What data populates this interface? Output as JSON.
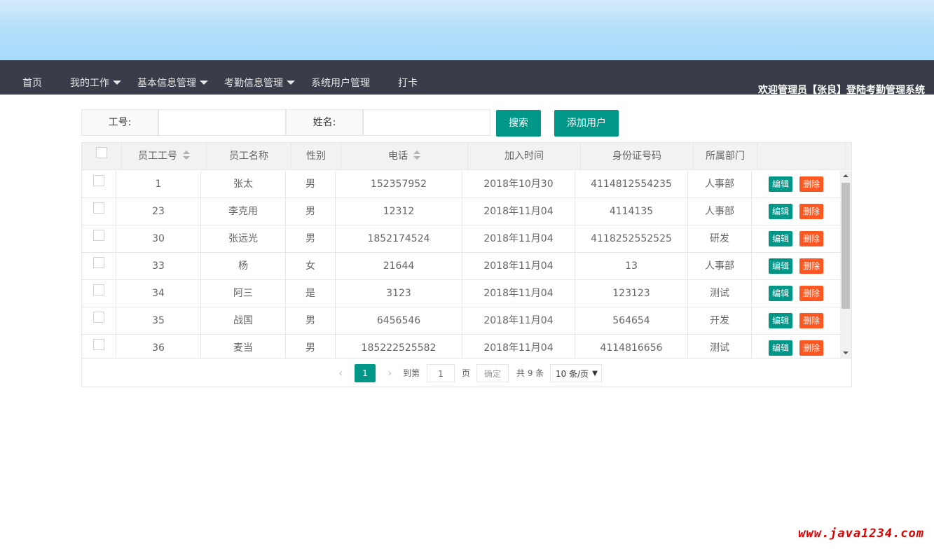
{
  "nav": {
    "items": [
      {
        "label": "首页",
        "dropdown": false
      },
      {
        "label": "我的工作",
        "dropdown": true
      },
      {
        "label": "基本信息管理",
        "dropdown": true
      },
      {
        "label": "考勤信息管理",
        "dropdown": true
      },
      {
        "label": "系统用户管理",
        "dropdown": false
      },
      {
        "label": "打卡",
        "dropdown": false
      }
    ],
    "welcome": "欢迎管理员【张良】登陆考勤管理系统"
  },
  "search": {
    "id_label": "工号:",
    "id_value": "",
    "name_label": "姓名:",
    "name_value": "",
    "search_button": "搜索",
    "add_button": "添加用户"
  },
  "table": {
    "columns": [
      "员工工号",
      "员工名称",
      "性别",
      "电话",
      "加入时间",
      "身份证号码",
      "所属部门"
    ],
    "rows": [
      {
        "id": "1",
        "name": "张太",
        "gender": "男",
        "phone": "152357952",
        "joined": "2018年10月30",
        "id_card": "4114812554235",
        "dept": "人事部"
      },
      {
        "id": "23",
        "name": "李克用",
        "gender": "男",
        "phone": "12312",
        "joined": "2018年11月04",
        "id_card": "4114135",
        "dept": "人事部"
      },
      {
        "id": "30",
        "name": "张远光",
        "gender": "男",
        "phone": "1852174524",
        "joined": "2018年11月04",
        "id_card": "4118252552525",
        "dept": "研发"
      },
      {
        "id": "33",
        "name": "杨",
        "gender": "女",
        "phone": "21644",
        "joined": "2018年11月04",
        "id_card": "13",
        "dept": "人事部"
      },
      {
        "id": "34",
        "name": "阿三",
        "gender": "是",
        "phone": "3123",
        "joined": "2018年11月04",
        "id_card": "123123",
        "dept": "测试"
      },
      {
        "id": "35",
        "name": "战国",
        "gender": "男",
        "phone": "6456546",
        "joined": "2018年11月04",
        "id_card": "564654",
        "dept": "开发"
      },
      {
        "id": "36",
        "name": "麦当",
        "gender": "男",
        "phone": "185222525582",
        "joined": "2018年11月04",
        "id_card": "4114816656",
        "dept": "测试"
      }
    ],
    "edit_label": "编辑",
    "delete_label": "删除"
  },
  "pager": {
    "prev_icon": "‹",
    "next_icon": "›",
    "current_page": "1",
    "goto_label": "到第",
    "goto_value": "1",
    "page_label": "页",
    "confirm_label": "确定",
    "total_label": "共 9 条",
    "page_size": "10 条/页"
  },
  "watermark": "www.java1234.com",
  "colors": {
    "accent": "#009688",
    "danger": "#ff5722",
    "navbar": "#393d49"
  }
}
